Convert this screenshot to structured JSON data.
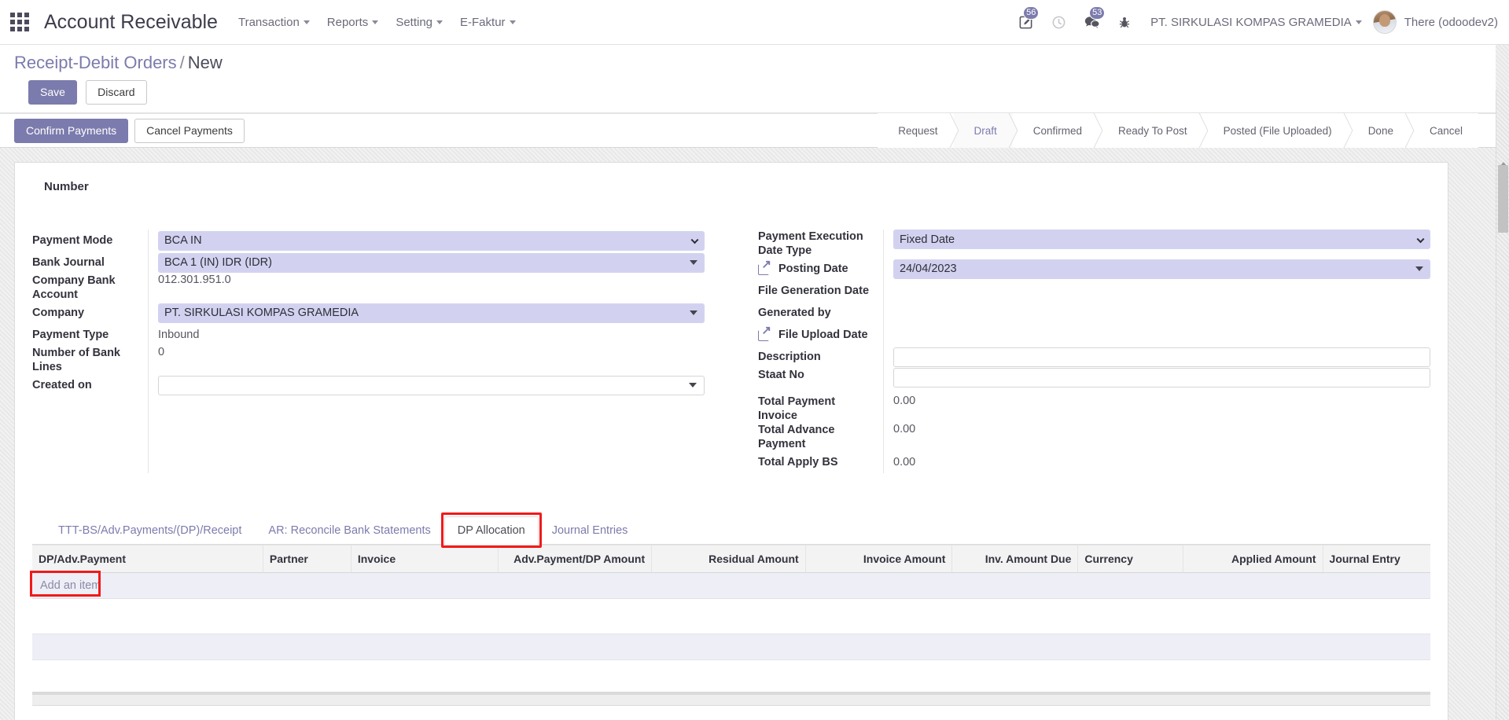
{
  "topbar": {
    "apps_icon": "apps-grid-icon",
    "app_title": "Account Receivable",
    "menus": [
      {
        "label": "Transaction"
      },
      {
        "label": "Reports"
      },
      {
        "label": "Setting"
      },
      {
        "label": "E-Faktur"
      }
    ],
    "activities_badge": "56",
    "messages_badge": "53",
    "company": "PT. SIRKULASI KOMPAS GRAMEDIA",
    "user": "There (odoodev2)"
  },
  "breadcrumb": {
    "root": "Receipt-Debit Orders",
    "separator": "/",
    "current": "New"
  },
  "savebar": {
    "save": "Save",
    "discard": "Discard"
  },
  "statusbar": {
    "confirm_payments": "Confirm Payments",
    "cancel_payments": "Cancel Payments",
    "pipeline": [
      {
        "label": "Request",
        "active": false
      },
      {
        "label": "Draft",
        "active": true
      },
      {
        "label": "Confirmed",
        "active": false
      },
      {
        "label": "Ready To Post",
        "active": false
      },
      {
        "label": "Posted (File Uploaded)",
        "active": false
      },
      {
        "label": "Done",
        "active": false
      },
      {
        "label": "Cancel",
        "active": false
      }
    ]
  },
  "form": {
    "number_label": "Number",
    "left": {
      "payment_mode_label": "Payment Mode",
      "payment_mode_value": "BCA IN",
      "bank_journal_label": "Bank Journal",
      "bank_journal_value": "BCA 1 (IN) IDR (IDR)",
      "company_bank_account_label": "Company Bank Account",
      "company_bank_account_value": "012.301.951.0",
      "company_label": "Company",
      "company_value": "PT. SIRKULASI KOMPAS GRAMEDIA",
      "payment_type_label": "Payment Type",
      "payment_type_value": "Inbound",
      "number_of_bank_lines_label": "Number of Bank Lines",
      "number_of_bank_lines_value": "0",
      "created_on_label": "Created on",
      "created_on_value": ""
    },
    "right": {
      "payment_execution_date_type_label": "Payment Execution Date Type",
      "payment_execution_date_type_value": "Fixed Date",
      "posting_date_label": "Posting Date",
      "posting_date_value": "24/04/2023",
      "file_generation_date_label": "File Generation Date",
      "generated_by_label": "Generated by",
      "file_upload_date_label": "File Upload Date",
      "description_label": "Description",
      "description_value": "",
      "staat_no_label": "Staat No",
      "staat_no_value": "",
      "total_payment_invoice_label": "Total Payment Invoice",
      "total_payment_invoice_value": "0.00",
      "total_advance_payment_label": "Total Advance Payment",
      "total_advance_payment_value": "0.00",
      "total_apply_bs_label": "Total Apply BS",
      "total_apply_bs_value": "0.00"
    }
  },
  "tabs": [
    {
      "label": "TTT-BS/Adv.Payments/(DP)/Receipt",
      "active": false,
      "highlight": false
    },
    {
      "label": "AR: Reconcile Bank Statements",
      "active": false,
      "highlight": false
    },
    {
      "label": "DP Allocation",
      "active": true,
      "highlight": true
    },
    {
      "label": "Journal Entries",
      "active": false,
      "highlight": false
    }
  ],
  "grid": {
    "columns": [
      {
        "label": "DP/Adv.Payment",
        "align": "left"
      },
      {
        "label": "Partner",
        "align": "left"
      },
      {
        "label": "Invoice",
        "align": "left"
      },
      {
        "label": "Adv.Payment/DP Amount",
        "align": "right"
      },
      {
        "label": "Residual Amount",
        "align": "right"
      },
      {
        "label": "Invoice Amount",
        "align": "right"
      },
      {
        "label": "Inv. Amount Due",
        "align": "right"
      },
      {
        "label": "Currency",
        "align": "left"
      },
      {
        "label": "Applied Amount",
        "align": "right"
      },
      {
        "label": "Journal Entry",
        "align": "left"
      }
    ],
    "rows": [],
    "add_item": "Add an item"
  },
  "colors": {
    "accent": "#7c7bad",
    "field_bg": "#d2d2f0",
    "highlight": "#f11a1a",
    "row_bg": "#eeeef7"
  }
}
